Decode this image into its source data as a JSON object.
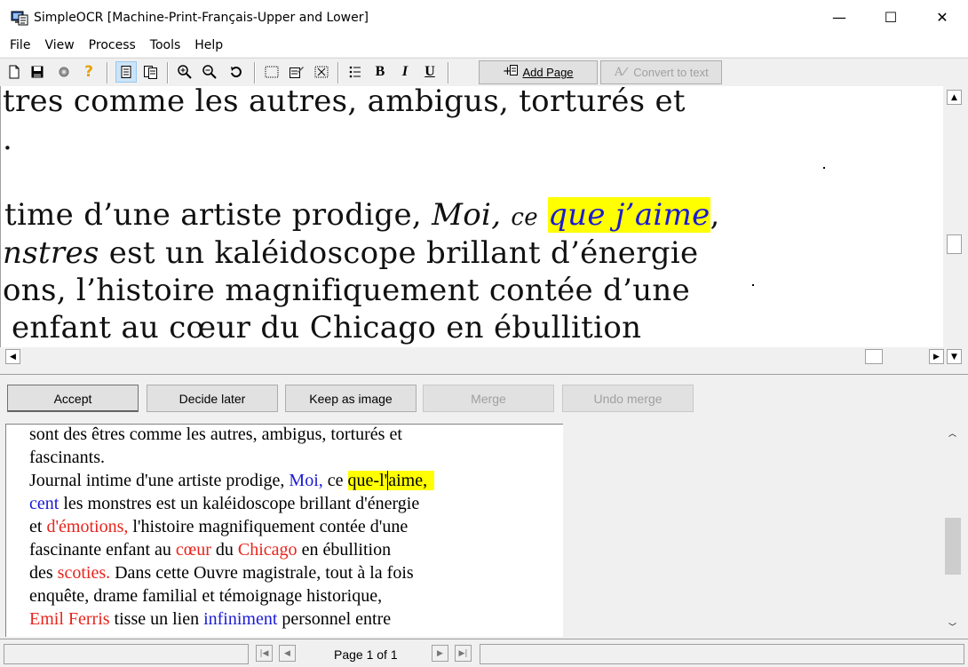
{
  "window": {
    "title": "SimpleOCR [Machine-Print-Français-Upper and Lower]",
    "minimize": "—",
    "maximize": "☐",
    "close": "✕"
  },
  "menu": [
    "File",
    "View",
    "Process",
    "Tools",
    "Help"
  ],
  "toolbar": {
    "add_page_label": "Add Page",
    "convert_label": "Convert to text",
    "bold": "B",
    "italic": "I",
    "underline": "U",
    "help": "?"
  },
  "image_pane": {
    "lines": [
      "tres comme les autres, ambigus, torturés et",
      ".",
      "time d’une artiste prodige,",
      "nstres",
      " est un kaléidoscope brillant d’énergie",
      "ons, l’histoire magnifiquement contée d’une",
      " enfant au cœur du Chicago en ébullition"
    ],
    "italic_moi": "Moi,",
    "italic_ce": "ce",
    "highlight": "que j’aime",
    "comma": ","
  },
  "actions": {
    "accept": "Accept",
    "decide_later": "Decide later",
    "keep_as_image": "Keep as image",
    "merge": "Merge",
    "undo_merge": "Undo merge"
  },
  "ocr_text": {
    "l1": "sont des êtres comme les autres, ambigus, torturés et",
    "l2": "fascinants.",
    "l3a": "Journal intime d'une artiste prodige, ",
    "l3b": "Moi,",
    "l3c": " ce ",
    "l3d": "que-l'",
    "l3e": "aime,",
    "l4a": "cent",
    "l4b": " les monstres est un kaléidoscope brillant d'énergie",
    "l5a": "et ",
    "l5b": "d'émotions,",
    "l5c": " l'histoire magnifiquement contée d'une",
    "l6a": "fascinante enfant au ",
    "l6b": "cœur",
    "l6c": " du ",
    "l6d": "Chicago",
    "l6e": " en ébullition",
    "l7a": "des ",
    "l7b": "scoties.",
    "l7c": " Dans cette Ouvre magistrale, tout à la fois",
    "l8": "enquête, drame familial et témoignage historique,",
    "l9a": "Emil Ferris",
    "l9b": " tisse un lien ",
    "l9c": "infiniment",
    "l9d": " personnel entre"
  },
  "status": {
    "page_label": "Page 1 of 1"
  },
  "colors": {
    "suspect_red": "#e8241c",
    "suspect_blue": "#1a1ad6",
    "highlight_yellow": "#ffff00"
  }
}
